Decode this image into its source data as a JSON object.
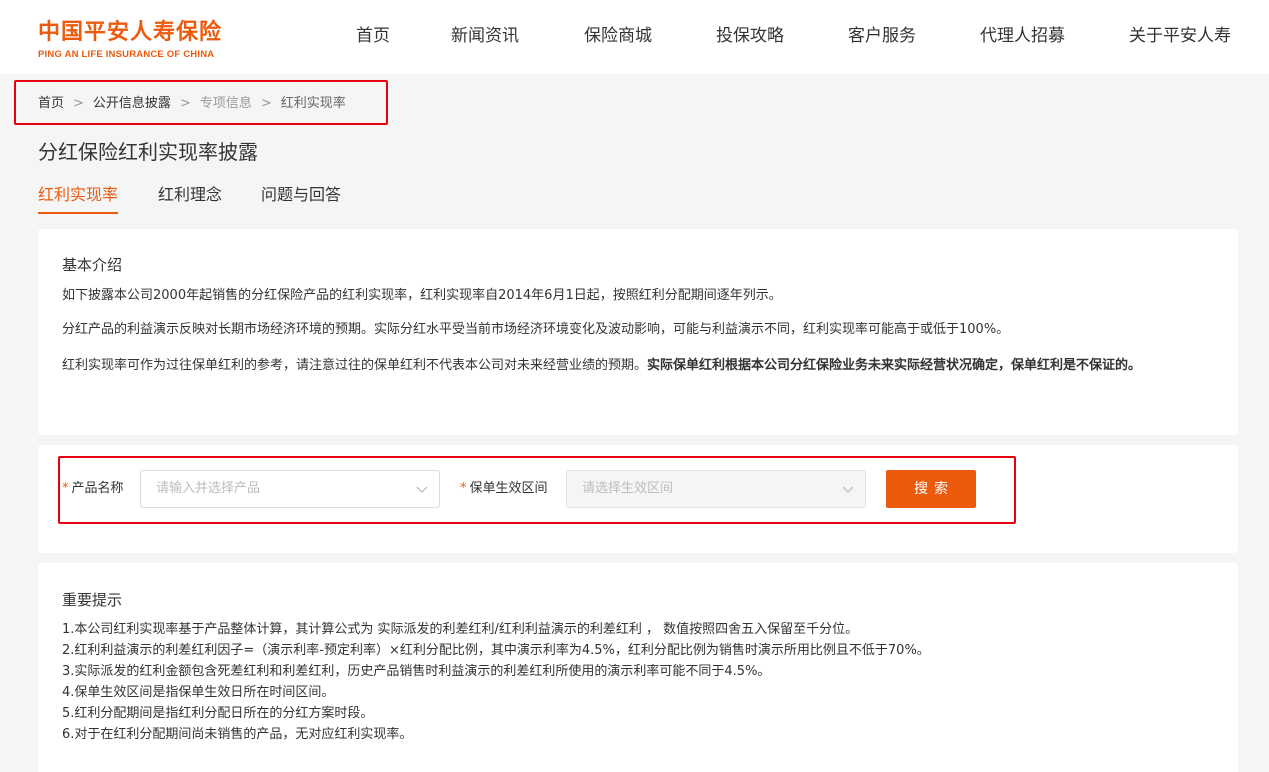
{
  "header": {
    "logo_cn": "中国平安人寿保险",
    "logo_en": "PING AN LIFE INSURANCE OF CHINA",
    "nav": [
      "首页",
      "新闻资讯",
      "保险商城",
      "投保攻略",
      "客户服务",
      "代理人招募",
      "关于平安人寿"
    ]
  },
  "breadcrumb": {
    "items": [
      "首页",
      "公开信息披露",
      "专项信息",
      "红利实现率"
    ],
    "separator": ">"
  },
  "page": {
    "title": "分红保险红利实现率披露"
  },
  "tabs": [
    "红利实现率",
    "红利理念",
    "问题与回答"
  ],
  "intro": {
    "title": "基本介绍",
    "p1": "如下披露本公司2000年起销售的分红保险产品的红利实现率，红利实现率自2014年6月1日起，按照红利分配期间逐年列示。",
    "p2": "分红产品的利益演示反映对长期市场经济环境的预期。实际分红水平受当前市场经济环境变化及波动影响，可能与利益演示不同，红利实现率可能高于或低于100%。",
    "p3_normal": "红利实现率可作为过往保单红利的参考，请注意过往的保单红利不代表本公司对未来经营业绩的预期。",
    "p3_bold": "实际保单红利根据本公司分红保险业务未来实际经营状况确定，保单红利是不保证的。"
  },
  "search": {
    "required_mark": "*",
    "product_label": "产品名称",
    "product_placeholder": "请输入并选择产品",
    "period_label": "保单生效区间",
    "period_placeholder": "请选择生效区间",
    "button": "搜索"
  },
  "notice": {
    "title": "重要提示",
    "items": [
      "1.本公司红利实现率基于产品整体计算，其计算公式为 实际派发的利差红利/红利利益演示的利差红利 ， 数值按照四舍五入保留至千分位。",
      "2.红利利益演示的利差红利因子=（演示利率-预定利率）×红利分配比例，其中演示利率为4.5%，红利分配比例为销售时演示所用比例且不低于70%。",
      "3.实际派发的红利金额包含死差红利和利差红利，历史产品销售时利益演示的利差红利所使用的演示利率可能不同于4.5%。",
      "4.保单生效区间是指保单生效日所在时间区间。",
      "5.红利分配期间是指红利分配日所在的分红方案时段。",
      "6.对于在红利分配期间尚未销售的产品，无对应红利实现率。"
    ]
  },
  "colors": {
    "brand": "#ec5a0e",
    "highlight_box": "#e60012"
  },
  "icons": {
    "dropdown": "chevron-down-icon"
  }
}
